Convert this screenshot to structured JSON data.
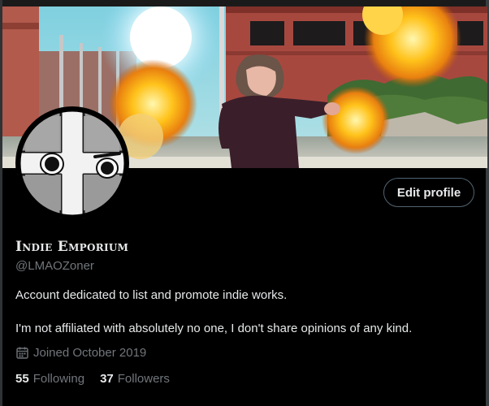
{
  "profile": {
    "display_name": "Indie Emporium",
    "handle": "@LMAOZoner",
    "bio": [
      "Account dedicated to list and promote indie works.",
      "I'm not affiliated with absolutely no one, I don't share opinions of any kind."
    ],
    "joined": "Joined October 2019",
    "following": {
      "count": "55",
      "label": "Following"
    },
    "followers": {
      "count": "37",
      "label": "Followers"
    }
  },
  "actions": {
    "edit_profile_label": "Edit profile"
  },
  "icons": {
    "joined": "calendar-icon"
  },
  "colors": {
    "background": "#000000",
    "primary_text": "#e7e9ea",
    "secondary_text": "#71767b",
    "button_border": "#536471"
  }
}
